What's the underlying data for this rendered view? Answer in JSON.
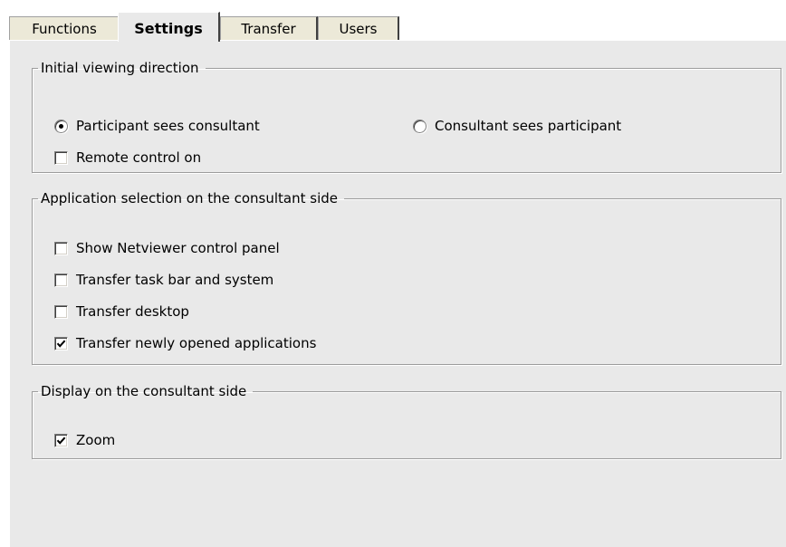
{
  "tabs": [
    {
      "label": "Functions",
      "active": false
    },
    {
      "label": "Settings",
      "active": true
    },
    {
      "label": "Transfer",
      "active": false
    },
    {
      "label": "Users",
      "active": false
    }
  ],
  "viewing_direction": {
    "title": "Initial viewing direction",
    "options": [
      {
        "label": "Participant sees consultant",
        "selected": true
      },
      {
        "label": "Consultant sees participant",
        "selected": false
      }
    ],
    "remote_control": {
      "label": "Remote control on",
      "checked": false
    }
  },
  "application_selection": {
    "title": "Application selection on the consultant side",
    "items": [
      {
        "label": "Show Netviewer control panel",
        "checked": false
      },
      {
        "label": "Transfer task bar and system",
        "checked": false
      },
      {
        "label": "Transfer desktop",
        "checked": false
      },
      {
        "label": "Transfer newly opened applications",
        "checked": true
      }
    ]
  },
  "display": {
    "title": "Display on the consultant side",
    "zoom": {
      "label": "Zoom",
      "checked": true
    }
  },
  "colors": {
    "panel_background": "#e9e9e9",
    "tab_background": "#ece9d8",
    "group_border": "#9c9c9c"
  }
}
